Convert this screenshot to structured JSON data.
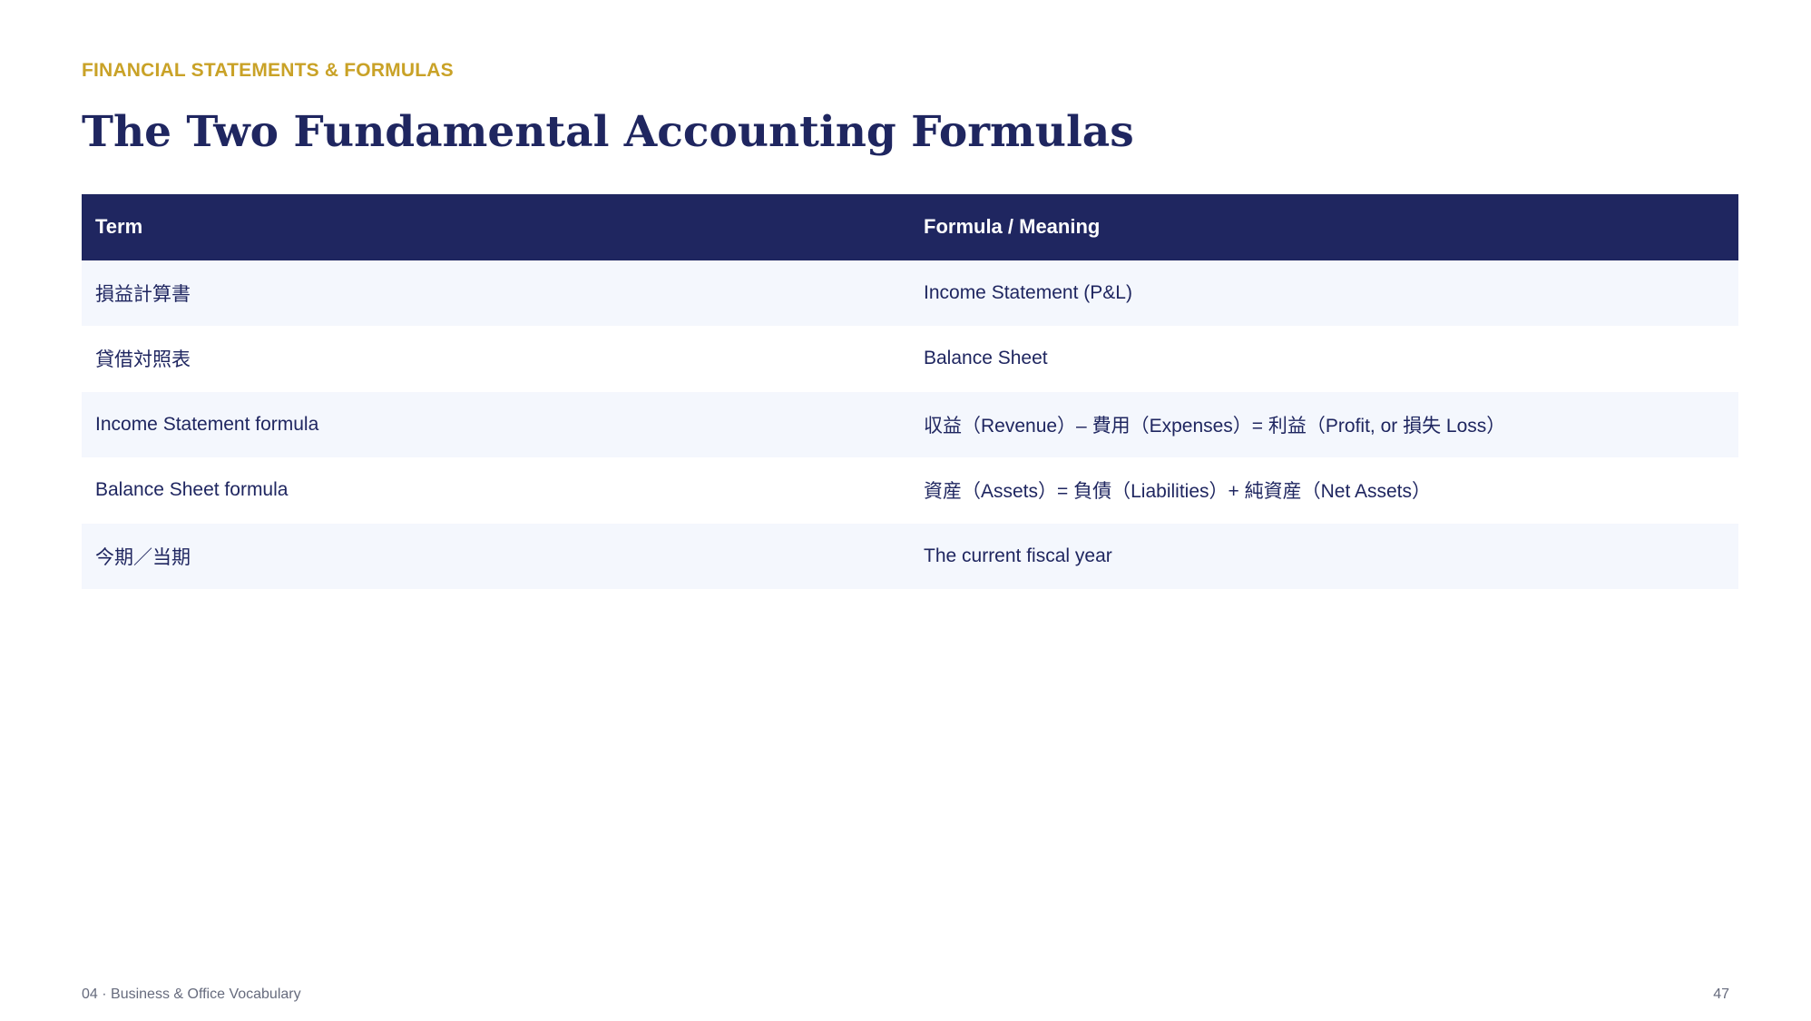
{
  "slide": {
    "eyebrow": "FINANCIAL STATEMENTS & FORMULAS",
    "title": "The Two Fundamental Accounting Formulas"
  },
  "table": {
    "headers": [
      "Term",
      "Formula / Meaning"
    ],
    "rows": [
      {
        "term": "損益計算書",
        "meaning": "Income Statement (P&L)"
      },
      {
        "term": "貸借対照表",
        "meaning": "Balance Sheet"
      },
      {
        "term": "Income Statement formula",
        "meaning": "収益（Revenue）– 費用（Expenses）= 利益（Profit, or 損失 Loss）"
      },
      {
        "term": "Balance Sheet formula",
        "meaning": "資産（Assets）= 負債（Liabilities）+ 純資産（Net Assets）"
      },
      {
        "term": "今期／当期",
        "meaning": "The current fiscal year"
      }
    ]
  },
  "footer": {
    "section": "04 · Business & Office Vocabulary",
    "page_number": "47"
  },
  "colors": {
    "navy": "#1f2660",
    "gold": "#c9a227",
    "row_alt": "#f4f7fd"
  }
}
